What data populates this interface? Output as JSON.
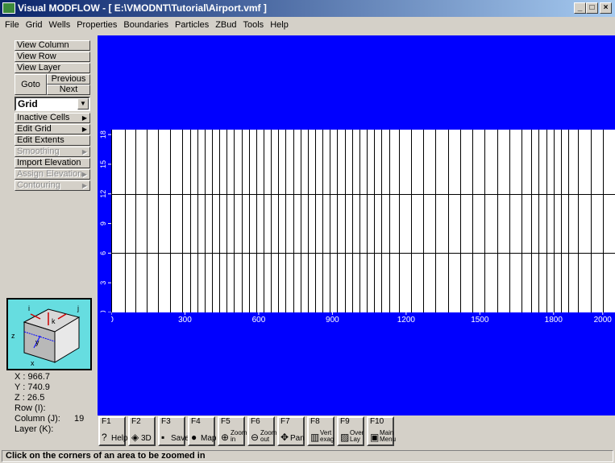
{
  "window": {
    "title": "Visual MODFLOW - [ E:\\VMODNT\\Tutorial\\Airport.vmf ]",
    "min_glyph": "_",
    "max_glyph": "□",
    "close_glyph": "×"
  },
  "menu": [
    "File",
    "Grid",
    "Wells",
    "Properties",
    "Boundaries",
    "Particles",
    "ZBud",
    "Tools",
    "Help"
  ],
  "sidebar": {
    "view_column": "View Column",
    "view_row": "View Row",
    "view_layer": "View Layer",
    "goto": "Goto",
    "previous": "Previous",
    "next": "Next",
    "grid_select": "Grid",
    "inactive_cells": "Inactive Cells",
    "edit_grid": "Edit Grid",
    "edit_extents": "Edit Extents",
    "smoothing": "Smoothing",
    "import_elevation": "Import Elevation",
    "assign_elevation": "Assign Elevation",
    "contouring": "Contouring"
  },
  "coords": {
    "x_label": "X :",
    "x_value": "966.7",
    "y_label": "Y :",
    "y_value": "740.9",
    "z_label": "Z :",
    "z_value": "26.5",
    "row_label": "Row   (I):",
    "row_value": "",
    "col_label": "Column (J):",
    "col_value": "19",
    "layer_label": "Layer  (K):",
    "layer_value": ""
  },
  "cube_labels": [
    "i",
    "j",
    "k",
    "z",
    "x",
    "y"
  ],
  "plot": {
    "x_ticks": [
      "0",
      "300",
      "600",
      "900",
      "1200",
      "1500",
      "1800",
      "2000"
    ],
    "y_ticks": [
      "0",
      "3",
      "6",
      "9",
      "12",
      "15",
      "18"
    ],
    "column_lines": [
      0,
      55,
      100,
      145,
      190,
      240,
      290,
      320,
      350,
      380,
      410,
      440,
      470,
      500,
      530,
      560,
      590,
      620,
      650,
      680,
      710,
      740,
      770,
      800,
      830,
      860,
      890,
      920,
      950,
      980,
      1010,
      1040,
      1070,
      1100,
      1130,
      1170,
      1220,
      1270,
      1320,
      1370,
      1420,
      1470,
      1520,
      1570,
      1620,
      1670,
      1710,
      1740,
      1770,
      1800,
      1830,
      1860,
      1900,
      1950,
      2000
    ],
    "row_lines": [
      6,
      12
    ]
  },
  "fkeys": [
    {
      "num": "F1",
      "label": "Help",
      "icon": "?"
    },
    {
      "num": "F2",
      "label": "3D",
      "icon": "◈"
    },
    {
      "num": "F3",
      "label": "Save",
      "icon": "▪"
    },
    {
      "num": "F4",
      "label": "Map",
      "icon": "●"
    },
    {
      "num": "F5",
      "label": "Zoom in",
      "icon": "⊕"
    },
    {
      "num": "F6",
      "label": "Zoom out",
      "icon": "⊖"
    },
    {
      "num": "F7",
      "label": "Pan",
      "icon": "✥"
    },
    {
      "num": "F8",
      "label": "Vert exag",
      "icon": "▥"
    },
    {
      "num": "F9",
      "label": "Over Lay",
      "icon": "▨"
    },
    {
      "num": "F10",
      "label": "Main Menu",
      "icon": "▣"
    }
  ],
  "status": "Click on the corners of an area to be zoomed in",
  "colors": {
    "canvas": "#0000ff",
    "plot_bg": "#ffffff",
    "cube": "#66dde0"
  }
}
